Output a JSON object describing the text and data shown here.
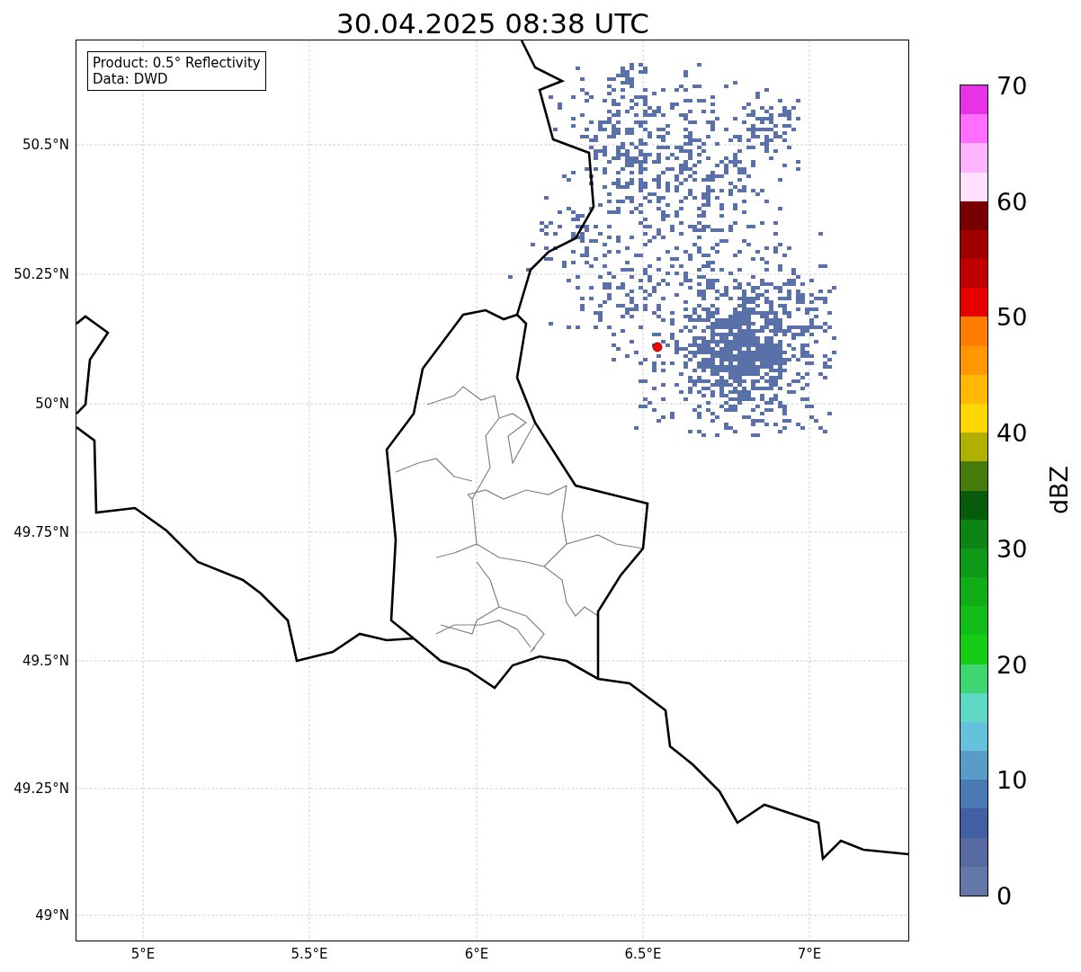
{
  "title": "30.04.2025 08:38 UTC",
  "map": {
    "info_box": [
      "Product: 0.5° Reflectivity",
      "Data: DWD"
    ],
    "yticks": [
      "50.5°N",
      "50.25°N",
      "50°N",
      "49.75°N",
      "49.5°N",
      "49.25°N",
      "49°N"
    ],
    "xticks": [
      "5°E",
      "5.5°E",
      "6°E",
      "6.5°E",
      "7°E"
    ]
  },
  "colorbar": {
    "label": "dBZ",
    "ticks": [
      "70",
      "60",
      "50",
      "40",
      "30",
      "20",
      "10",
      "0"
    ],
    "bands": [
      {
        "color": "#6577a8"
      },
      {
        "color": "#5868a0"
      },
      {
        "color": "#4360a4"
      },
      {
        "color": "#4a7ab4"
      },
      {
        "color": "#5a9cc8"
      },
      {
        "color": "#66c2dc"
      },
      {
        "color": "#5fd8c5"
      },
      {
        "color": "#3ed672"
      },
      {
        "color": "#14cd14"
      },
      {
        "color": "#12bd18"
      },
      {
        "color": "#10ad18"
      },
      {
        "color": "#0e9a18"
      },
      {
        "color": "#0c8414"
      },
      {
        "color": "#075c0b"
      },
      {
        "color": "#467a0a"
      },
      {
        "color": "#b0b000"
      },
      {
        "color": "#ffd700"
      },
      {
        "color": "#ffb800"
      },
      {
        "color": "#ff9800"
      },
      {
        "color": "#ff7d00"
      },
      {
        "color": "#e60000"
      },
      {
        "color": "#c00000"
      },
      {
        "color": "#a00000"
      },
      {
        "color": "#780000"
      },
      {
        "color": "#ffe0ff"
      },
      {
        "color": "#ffb4ff"
      },
      {
        "color": "#ff6eff"
      },
      {
        "color": "#e832e8"
      }
    ]
  }
}
